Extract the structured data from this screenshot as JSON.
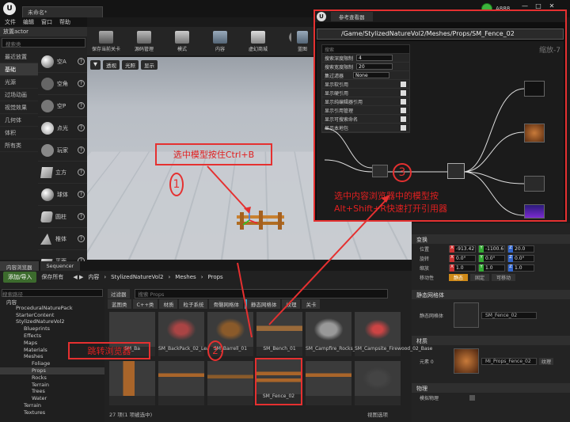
{
  "app": {
    "logo": "U",
    "doc_tab": "未命名*",
    "menu": [
      "文件",
      "编辑",
      "窗口",
      "帮助"
    ],
    "user_label": "A888",
    "window_controls": [
      "minimize-icon",
      "maximize-icon",
      "close-icon"
    ]
  },
  "place_actors": {
    "title": "放置actor",
    "search_placeholder": "搜索类",
    "categories": [
      "最近放置",
      "基础",
      "光源",
      "过场动画",
      "视觉效果",
      "几何体",
      "体积",
      "所有类"
    ],
    "selected_category": "基础",
    "items": [
      "空A",
      "空角",
      "空P",
      "点光",
      "玩家",
      "立方",
      "球体",
      "圆柱",
      "椎体",
      "平面"
    ]
  },
  "toolbar": {
    "buttons": [
      "保存当前关卡",
      "源码管理",
      "模式",
      "内容",
      "虚幻商城",
      "设置",
      "蓝图"
    ]
  },
  "viewport": {
    "buttons": [
      "透视",
      "光照",
      "显示"
    ]
  },
  "annotations": {
    "step1_text": "选中模型按住Ctrl+B",
    "step1_num": "1",
    "step2_text": "跳转浏览器",
    "step2_num": "2",
    "step3_text": "选中内容浏览器中的模型按\nAlt+Shift+R快速打开引用器",
    "step3_num": "3"
  },
  "ref_viewer": {
    "logo": "U",
    "tab": "参考查看器",
    "path": "/Game/StylizedNatureVol2/Meshes/Props/SM_Fence_02",
    "zoom": "缩放-7",
    "options": [
      {
        "label": "搜索",
        "type": "search"
      },
      {
        "label": "搜索深度限制",
        "type": "num",
        "value": "4"
      },
      {
        "label": "搜索宽度限制",
        "type": "num",
        "value": "20"
      },
      {
        "label": "集过滤器",
        "type": "select",
        "value": "None"
      },
      {
        "label": "显示软引用",
        "type": "check"
      },
      {
        "label": "显示硬引用",
        "type": "check"
      },
      {
        "label": "显示纯编辑器引用",
        "type": "check"
      },
      {
        "label": "显示引用管理",
        "type": "check"
      },
      {
        "label": "显示可搜索命名",
        "type": "check"
      },
      {
        "label": "显示本地包",
        "type": "check"
      }
    ]
  },
  "details": {
    "transform_header": "变换",
    "rows": [
      {
        "label": "位置",
        "x": "-913.42",
        "y": "-1100.6",
        "z": "20.0"
      },
      {
        "label": "旋转",
        "x": "0.0°",
        "y": "0.0°",
        "z": "0.0°"
      },
      {
        "label": "缩放",
        "x": "1.0",
        "y": "1.0",
        "z": "1.0"
      }
    ],
    "mobility_label": "移动性",
    "mobility": [
      "静态",
      "固定",
      "可移动"
    ],
    "mesh_header": "静态网格体",
    "mesh_label": "静态网格体",
    "mesh_value": "SM_Fence_02",
    "material_header": "材质",
    "material_label": "元素 0",
    "material_value": "MI_Props_Fence_02",
    "material_sub": "纹理",
    "physics_header": "物理",
    "physics_label": "模拟物理"
  },
  "content_browser": {
    "tabs": [
      "内容浏览器",
      "Sequencer"
    ],
    "add_import": "添加/导入",
    "save_all": "保存所有",
    "breadcrumb": [
      "内容",
      "StylizedNatureVol2",
      "Meshes",
      "Props"
    ],
    "tree_search": "搜索路径",
    "filter_btn": "过滤器",
    "asset_search": "搜索 Props",
    "filters": [
      "蓝图类",
      "C++类",
      "材质",
      "粒子系统",
      "骨骼网格体",
      "静态网格体",
      "纹理",
      "关卡"
    ],
    "tree": [
      {
        "t": "内容",
        "d": 0
      },
      {
        "t": "ProceduralNaturePack",
        "d": 1
      },
      {
        "t": "StarterContent",
        "d": 1
      },
      {
        "t": "StylizedNatureVol2",
        "d": 1
      },
      {
        "t": "Blueprints",
        "d": 2
      },
      {
        "t": "Effects",
        "d": 2
      },
      {
        "t": "Maps",
        "d": 2
      },
      {
        "t": "Materials",
        "d": 2
      },
      {
        "t": "Meshes",
        "d": 2
      },
      {
        "t": "Foliage",
        "d": 3
      },
      {
        "t": "Props",
        "d": 3
      },
      {
        "t": "Rocks",
        "d": 3
      },
      {
        "t": "Terrain",
        "d": 3
      },
      {
        "t": "Trees",
        "d": 3
      },
      {
        "t": "Water",
        "d": 3
      },
      {
        "t": "Terrain",
        "d": 2
      },
      {
        "t": "Textures",
        "d": 2
      }
    ],
    "assets": [
      "SM_Ba",
      "SM_BackPack_02_Leather",
      "SM_Barrell_01",
      "SM_Bench_01",
      "SM_Campfire_Rocks_Lit",
      "SM_Campsite_Firewood_02_Base",
      "",
      "",
      "",
      "SM_Fence_02",
      "",
      ""
    ],
    "status": "27 项(1 项被选中)",
    "view_options": "视图选项"
  }
}
